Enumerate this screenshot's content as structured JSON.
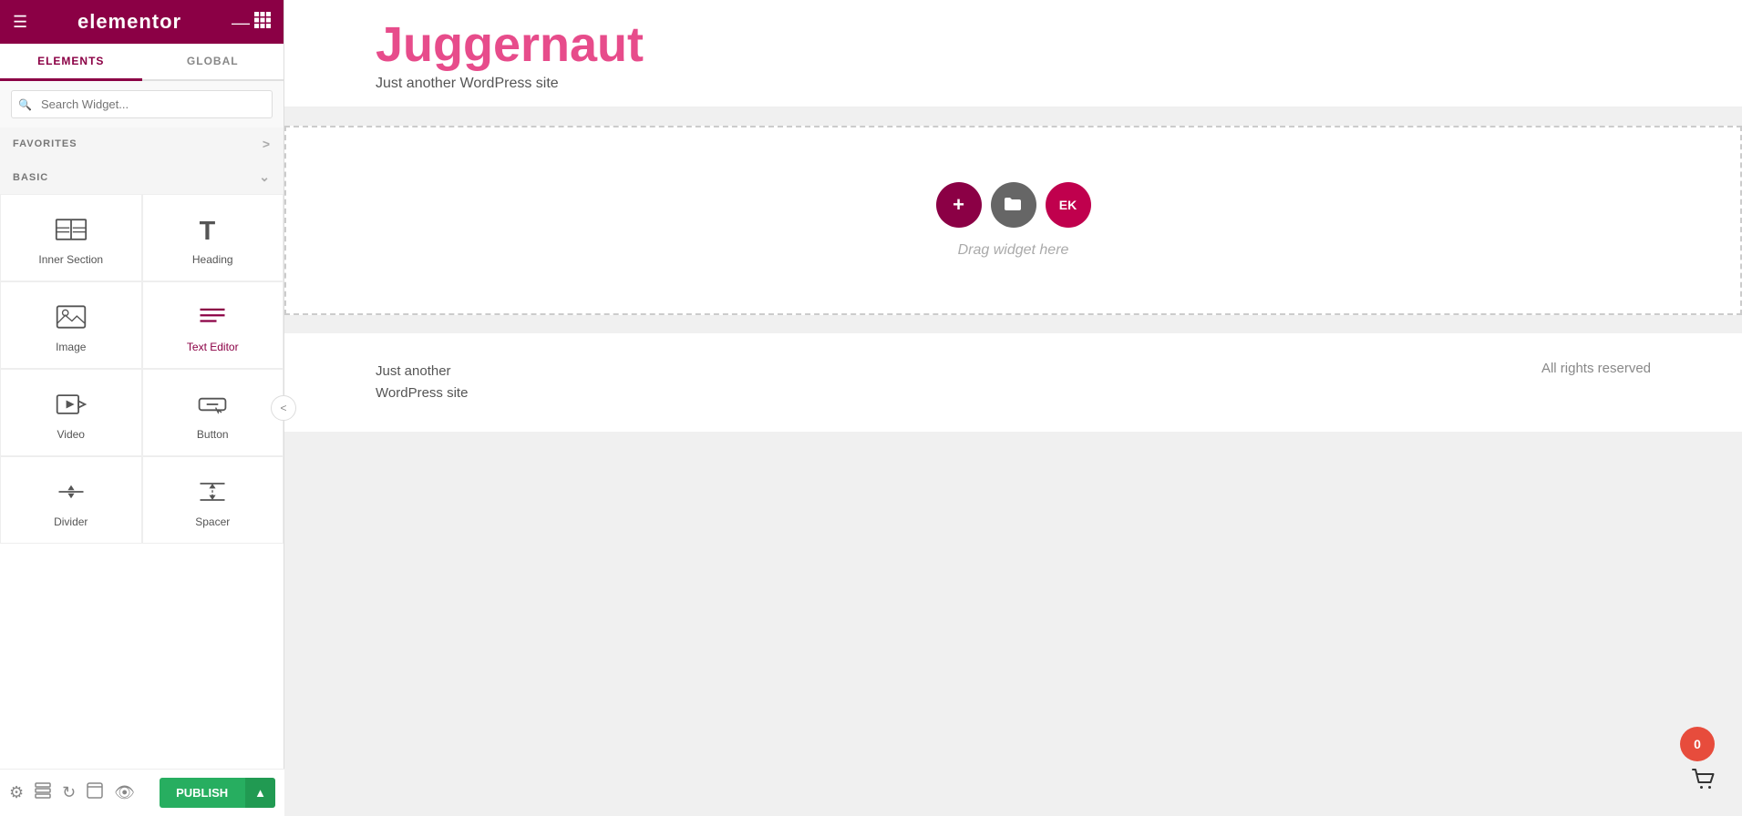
{
  "sidebar": {
    "logo": "elementor",
    "tabs": [
      {
        "id": "elements",
        "label": "ELEMENTS",
        "active": true
      },
      {
        "id": "global",
        "label": "GLOBAL",
        "active": false
      }
    ],
    "search": {
      "placeholder": "Search Widget..."
    },
    "favorites": {
      "label": "FAVORITES"
    },
    "basic": {
      "label": "BASIC"
    },
    "widgets": [
      {
        "id": "inner-section",
        "label": "Inner Section",
        "icon": "inner-section-icon"
      },
      {
        "id": "heading",
        "label": "Heading",
        "icon": "heading-icon"
      },
      {
        "id": "image",
        "label": "Image",
        "icon": "image-icon"
      },
      {
        "id": "text-editor",
        "label": "Text Editor",
        "icon": "text-editor-icon",
        "active": true
      },
      {
        "id": "video",
        "label": "Video",
        "icon": "video-icon"
      },
      {
        "id": "button",
        "label": "Button",
        "icon": "button-icon"
      },
      {
        "id": "divider",
        "label": "Divider",
        "icon": "divider-icon"
      },
      {
        "id": "spacer",
        "label": "Spacer",
        "icon": "spacer-icon"
      }
    ],
    "bottom_icons": [
      "settings-icon",
      "layers-icon",
      "history-icon",
      "page-settings-icon",
      "preview-icon"
    ],
    "publish_label": "PUBLISH"
  },
  "main": {
    "site_title": "Juggernaut",
    "site_tagline": "Just another WordPress site",
    "canvas": {
      "drag_hint": "Drag widget here",
      "add_btn_label": "+",
      "folder_btn_label": "📁",
      "ek_btn_label": "EK"
    },
    "footer": {
      "tagline": "Just another\nWordPress site",
      "rights": "All rights reserved"
    },
    "cart_count": "0"
  }
}
